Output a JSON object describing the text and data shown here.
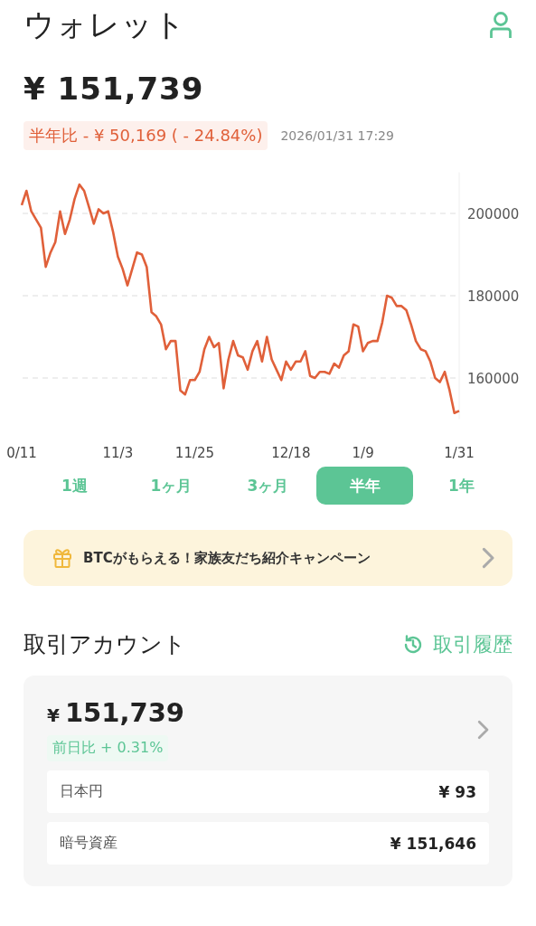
{
  "header": {
    "title": "ウォレット"
  },
  "balance": "¥ 151,739",
  "change": {
    "label": "半年比 - ¥ 50,169 ( - 24.84%)"
  },
  "timestamp": "2026/01/31 17:29",
  "chart_data": {
    "type": "line",
    "grid": true,
    "ylim": [
      150000,
      210000
    ],
    "yticks": [
      160000,
      180000,
      200000
    ],
    "categories": [
      "0/11",
      null,
      null,
      null,
      null,
      null,
      null,
      null,
      null,
      null,
      null,
      null,
      null,
      null,
      null,
      null,
      null,
      null,
      null,
      null,
      "11/3",
      null,
      null,
      null,
      null,
      null,
      null,
      null,
      null,
      null,
      null,
      null,
      null,
      null,
      null,
      null,
      "11/25",
      null,
      null,
      null,
      null,
      null,
      null,
      null,
      null,
      null,
      null,
      null,
      null,
      null,
      null,
      null,
      null,
      null,
      null,
      null,
      "12/18",
      null,
      null,
      null,
      null,
      null,
      null,
      null,
      null,
      null,
      null,
      null,
      null,
      null,
      null,
      "1/9",
      null,
      null,
      null,
      null,
      null,
      null,
      null,
      null,
      null,
      null,
      null,
      null,
      null,
      null,
      null,
      null,
      null,
      null,
      null,
      "1/31"
    ],
    "series": [
      {
        "color": "#e0603a",
        "values": [
          202000,
          205500,
          200500,
          198500,
          196500,
          187000,
          190500,
          193000,
          200500,
          195000,
          198500,
          203500,
          207000,
          205500,
          201500,
          197500,
          201000,
          200000,
          200500,
          195500,
          189500,
          186500,
          182500,
          186500,
          190500,
          190000,
          187000,
          176000,
          175000,
          173000,
          167000,
          169000,
          169000,
          157000,
          156000,
          159500,
          159500,
          161500,
          167000,
          170000,
          167500,
          168500,
          157500,
          164500,
          169000,
          165500,
          165000,
          162000,
          166500,
          169000,
          164000,
          170000,
          164500,
          162000,
          159500,
          164000,
          162000,
          164000,
          164000,
          166500,
          160500,
          160000,
          161500,
          161500,
          161000,
          163500,
          162500,
          165500,
          166500,
          173000,
          172500,
          166500,
          168500,
          169000,
          169000,
          173500,
          180000,
          179500,
          177500,
          177500,
          176500,
          173000,
          169000,
          167000,
          166500,
          164000,
          160000,
          159000,
          161500,
          157000,
          151500,
          152000
        ]
      }
    ]
  },
  "periods": [
    {
      "label": "1週",
      "selected": false
    },
    {
      "label": "1ヶ月",
      "selected": false
    },
    {
      "label": "3ヶ月",
      "selected": false
    },
    {
      "label": "半年",
      "selected": true
    },
    {
      "label": "1年",
      "selected": false
    }
  ],
  "banner": {
    "text": "BTCがもらえる！家族友だち紹介キャンペーン"
  },
  "account": {
    "title": "取引アカウント",
    "history_link": "取引履歴",
    "currency_symbol": "¥",
    "amount": "151,739",
    "change": {
      "label": "前日比 + 0.31%"
    },
    "rows": [
      {
        "label": "日本円",
        "value": "¥ 93"
      },
      {
        "label": "暗号資産",
        "value": "¥ 151,646"
      }
    ]
  }
}
